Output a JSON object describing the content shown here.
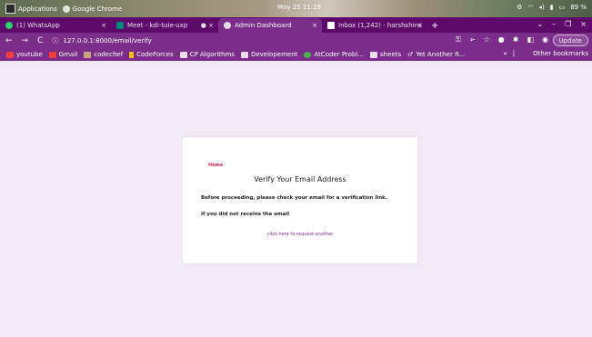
{
  "os": {
    "applications_label": "Applications",
    "chrome_label": "Google Chrome",
    "clock": "May 25 11:19",
    "tray": [
      "wifi-icon",
      "volume-icon",
      "mic-icon",
      "battery-icon"
    ],
    "battery": "89 %"
  },
  "tabs": [
    {
      "title": "(1) WhatsApp",
      "icon": "whatsapp-icon",
      "color": "#25d366"
    },
    {
      "title": "Meet - kdi-tuie-uxp",
      "icon": "meet-icon",
      "color": "#00897b"
    },
    {
      "title": "Admin Dashboard",
      "icon": "chrome-icon",
      "color": "#dddddd",
      "active": true
    },
    {
      "title": "Inbox (1,242) - harshshinc",
      "icon": "gmail-icon",
      "color": "#ffffff"
    }
  ],
  "omnibox": {
    "url": "127.0.0.1:8000/email/verify"
  },
  "toolbar": {
    "update_label": "Update"
  },
  "bookmarks": [
    {
      "label": "youtube",
      "icon": "youtube-icon",
      "color": "#ff3b30"
    },
    {
      "label": "Gmail",
      "icon": "gmail-icon",
      "color": "#ea4335"
    },
    {
      "label": "codechef",
      "icon": "codechef-icon",
      "color": "#c9a47a"
    },
    {
      "label": "CodeForces",
      "icon": "codeforces-icon",
      "color": "#f4c20d"
    },
    {
      "label": "CP Algorithms",
      "icon": "folder-icon",
      "color": "#e9dced"
    },
    {
      "label": "Developement",
      "icon": "folder-icon",
      "color": "#e9dced"
    },
    {
      "label": "AtCoder Probl...",
      "icon": "atcoder-icon",
      "color": "#4caf50"
    },
    {
      "label": "sheets",
      "icon": "folder-icon",
      "color": "#e9dced"
    },
    {
      "label": "Yet Another R...",
      "icon": "link-icon",
      "color": "#e9dced"
    }
  ],
  "other_bookmarks": "Other bookmarks",
  "card": {
    "home_link": "Home",
    "title": "Verify Your Email Address",
    "line1": "Before proceeding, please check your email for a verification link.",
    "line2": "If you did not receive the email",
    "resend_link": "click here to request another"
  }
}
